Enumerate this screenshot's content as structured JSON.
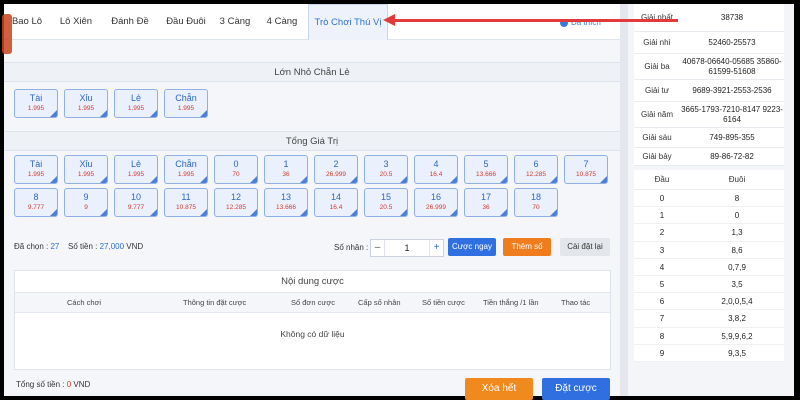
{
  "tabs": [
    {
      "label": "Bao Lô"
    },
    {
      "label": "Lô Xiên"
    },
    {
      "label": "Đánh Đề"
    },
    {
      "label": "Đầu Đuôi"
    },
    {
      "label": "3 Càng"
    },
    {
      "label": "4 Càng"
    },
    {
      "label": "Trò Chơi Thú Vị",
      "active": true
    }
  ],
  "favorite_label": "Đã thích",
  "sections": {
    "big_small": {
      "title": "Lớn Nhỏ Chẵn Lẻ",
      "bets": [
        {
          "name": "Tài",
          "odds": "1.995"
        },
        {
          "name": "Xỉu",
          "odds": "1.995"
        },
        {
          "name": "Lẻ",
          "odds": "1.995"
        },
        {
          "name": "Chẵn",
          "odds": "1.995"
        }
      ]
    },
    "total_value": {
      "title": "Tổng Giá Trị",
      "row1": [
        {
          "name": "Tài",
          "odds": "1.995"
        },
        {
          "name": "Xỉu",
          "odds": "1.995"
        },
        {
          "name": "Lẻ",
          "odds": "1.995"
        },
        {
          "name": "Chẵn",
          "odds": "1.995"
        },
        {
          "name": "0",
          "odds": "70"
        },
        {
          "name": "1",
          "odds": "36"
        },
        {
          "name": "2",
          "odds": "26.999"
        },
        {
          "name": "3",
          "odds": "20.5"
        },
        {
          "name": "4",
          "odds": "16.4"
        },
        {
          "name": "5",
          "odds": "13.666"
        },
        {
          "name": "6",
          "odds": "12.285"
        },
        {
          "name": "7",
          "odds": "10.875"
        }
      ],
      "row2": [
        {
          "name": "8",
          "odds": "9.777"
        },
        {
          "name": "9",
          "odds": "9"
        },
        {
          "name": "10",
          "odds": "9.777"
        },
        {
          "name": "11",
          "odds": "10.875"
        },
        {
          "name": "12",
          "odds": "12.285"
        },
        {
          "name": "13",
          "odds": "13.666"
        },
        {
          "name": "14",
          "odds": "16.4"
        },
        {
          "name": "15",
          "odds": "20.5"
        },
        {
          "name": "16",
          "odds": "26.999"
        },
        {
          "name": "17",
          "odds": "36"
        },
        {
          "name": "18",
          "odds": "70"
        }
      ]
    }
  },
  "summary": {
    "selected_label": "Đã chọn :",
    "selected_value": "27",
    "amount_label": "Số tiền :",
    "amount_value": "27,000",
    "currency": "VND",
    "multiplier_label": "Số nhân :",
    "minus": "–",
    "plus": "+",
    "multiplier_value": "1"
  },
  "buttons": {
    "quick_bet": "Cược ngay",
    "add": "Thêm số",
    "reset": "Cài đặt lại",
    "clear": "Xóa hết",
    "place_bet": "Đặt cược"
  },
  "content": {
    "title": "Nội dung cược",
    "columns": [
      "Cách chơi",
      "Thông tin đặt cược",
      "Số đơn cược",
      "Cấp số nhân",
      "Số tiền cược",
      "Tiền thắng /1 lần",
      "Thao tác"
    ],
    "empty": "Không có dữ liệu"
  },
  "total": {
    "label": "Tổng số tiền :",
    "value": "0",
    "currency": "VND"
  },
  "results": [
    {
      "label": "Giải nhất",
      "value": "38738"
    },
    {
      "label": "Giải nhì",
      "value": "52460-25573"
    },
    {
      "label": "Giải ba",
      "value": "40678-06640-05685 35860-61599-51608"
    },
    {
      "label": "Giải tư",
      "value": "9689-3921-2553-2536"
    },
    {
      "label": "Giải năm",
      "value": "3665-1793-7210-8147 9223-6164"
    },
    {
      "label": "Giải sáu",
      "value": "749-895-355"
    },
    {
      "label": "Giải bảy",
      "value": "89-86-72-82"
    }
  ],
  "head_tail": {
    "col_head": "Đầu",
    "col_tail": "Đuôi",
    "rows": [
      {
        "head": "0",
        "tail": "8"
      },
      {
        "head": "1",
        "tail": "0"
      },
      {
        "head": "2",
        "tail": "1,3"
      },
      {
        "head": "3",
        "tail": "8,6"
      },
      {
        "head": "4",
        "tail": "0,7,9"
      },
      {
        "head": "5",
        "tail": "3,5"
      },
      {
        "head": "6",
        "tail": "2,0,0,5,4"
      },
      {
        "head": "7",
        "tail": "3,8,2"
      },
      {
        "head": "8",
        "tail": "5,9,9,6,2"
      },
      {
        "head": "9",
        "tail": "9,3,5"
      }
    ]
  },
  "colors": {
    "accent": "#2f6fe0",
    "orange": "#f07d1d",
    "odds_red": "#d33a2c",
    "annotation_arrow": "#e23a3a"
  }
}
